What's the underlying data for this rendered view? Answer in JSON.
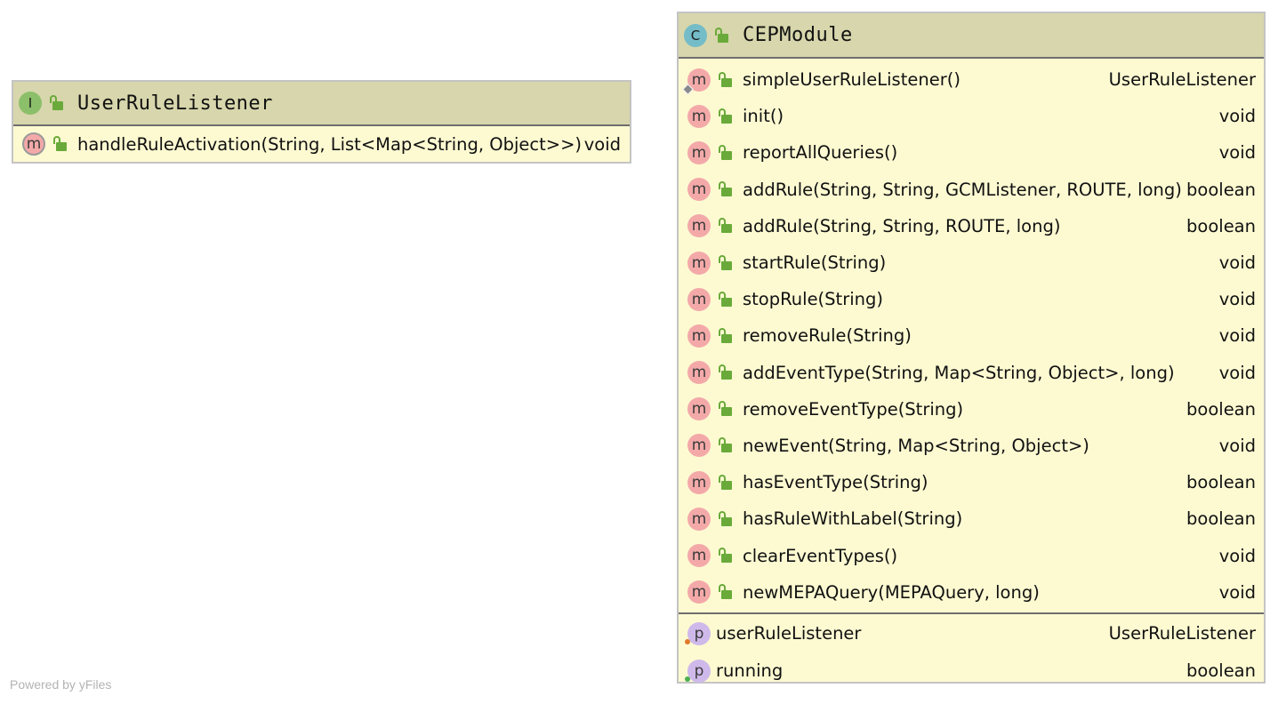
{
  "user_rule_listener": {
    "kind_letter": "I",
    "title": "UserRuleListener",
    "methods": [
      {
        "name": "handleRuleActivation(String, List<Map<String, Object>>)",
        "type": "void"
      }
    ]
  },
  "cep_module": {
    "kind_letter": "C",
    "title": "CEPModule",
    "methods": [
      {
        "name": "simpleUserRuleListener()",
        "type": "UserRuleListener"
      },
      {
        "name": "init()",
        "type": "void"
      },
      {
        "name": "reportAllQueries()",
        "type": "void"
      },
      {
        "name": "addRule(String, String, GCMListener, ROUTE, long)",
        "type": "boolean"
      },
      {
        "name": "addRule(String, String, ROUTE, long)",
        "type": "boolean"
      },
      {
        "name": "startRule(String)",
        "type": "void"
      },
      {
        "name": "stopRule(String)",
        "type": "void"
      },
      {
        "name": "removeRule(String)",
        "type": "void"
      },
      {
        "name": "addEventType(String, Map<String, Object>, long)",
        "type": "void"
      },
      {
        "name": "removeEventType(String)",
        "type": "boolean"
      },
      {
        "name": "newEvent(String, Map<String, Object>)",
        "type": "void"
      },
      {
        "name": "hasEventType(String)",
        "type": "boolean"
      },
      {
        "name": "hasRuleWithLabel(String)",
        "type": "boolean"
      },
      {
        "name": "clearEventTypes()",
        "type": "void"
      },
      {
        "name": "newMEPAQuery(MEPAQuery, long)",
        "type": "void"
      }
    ],
    "properties": [
      {
        "name": "userRuleListener",
        "type": "UserRuleListener"
      },
      {
        "name": "running",
        "type": "boolean"
      }
    ]
  },
  "badges": {
    "method_letter": "m",
    "property_letter": "p"
  },
  "colors": {
    "interface_badge": "#8cbf6a",
    "class_badge": "#74bcc8",
    "header_bg": "#d7d6ac",
    "body_bg": "#fdfad2",
    "lock_green": "#6aaa3a",
    "getter_dot": "#e0782a",
    "field_dot": "#4caf50"
  },
  "watermark": "Powered by yFiles"
}
